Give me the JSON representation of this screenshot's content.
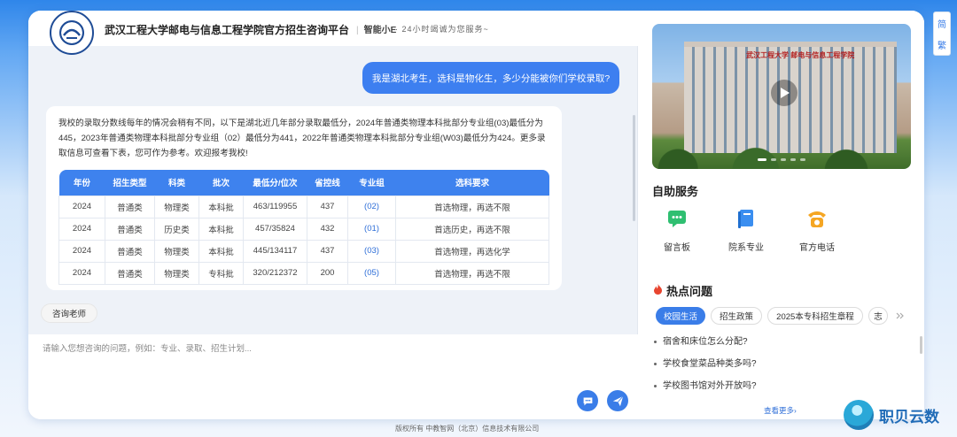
{
  "header": {
    "title": "武汉工程大学邮电与信息工程学院官方招生咨询平台",
    "brand": "智能小E",
    "slogan": "24小时竭诚为您服务~"
  },
  "chat": {
    "user_message": "我是湖北考生，选科是物化生，多少分能被你们学校录取?",
    "bot_message": "我校的录取分数线每年的情况会稍有不同，以下是湖北近几年部分录取最低分，2024年普通类物理本科批部分专业组(03)最低分为445，2023年普通类物理本科批部分专业组（02）最低分为441，2022年普通类物理本科批部分专业组(W03)最低分为424。更多录取信息可查看下表，您可作为参考。欢迎报考我校!",
    "table": {
      "headers": [
        "年份",
        "招生类型",
        "科类",
        "批次",
        "最低分/位次",
        "省控线",
        "专业组",
        "选科要求"
      ],
      "rows": [
        [
          "2024",
          "普通类",
          "物理类",
          "本科批",
          "463/119955",
          "437",
          "(02)",
          "首选物理，再选不限"
        ],
        [
          "2024",
          "普通类",
          "历史类",
          "本科批",
          "457/35824",
          "432",
          "(01)",
          "首选历史，再选不限"
        ],
        [
          "2024",
          "普通类",
          "物理类",
          "本科批",
          "445/134117",
          "437",
          "(03)",
          "首选物理，再选化学"
        ],
        [
          "2024",
          "普通类",
          "物理类",
          "专科批",
          "320/212372",
          "200",
          "(05)",
          "首选物理，再选不限"
        ]
      ]
    },
    "teacher_button": "咨询老师",
    "input_placeholder": "请输入您想咨询的问题，例如：专业、录取、招生计划..."
  },
  "sidebar": {
    "video_sign": "武汉工程大学 邮电与信息工程学院",
    "self_service_title": "自助服务",
    "services": [
      {
        "label": "留言板",
        "icon": "message-board-icon",
        "color": "#2fbf71"
      },
      {
        "label": "院系专业",
        "icon": "book-icon",
        "color": "#3a8ef0"
      },
      {
        "label": "官方电话",
        "icon": "phone-icon",
        "color": "#f5a623"
      }
    ],
    "hot_title": "热点问题",
    "tabs": [
      "校园生活",
      "招生政策",
      "2025本专科招生章程",
      "志"
    ],
    "questions": [
      "宿舍和床位怎么分配?",
      "学校食堂菜品种类多吗?",
      "学校图书馆对外开放吗?"
    ],
    "more": "查看更多"
  },
  "lang": {
    "simplified": "简",
    "traditional": "繁"
  },
  "footer": "版权所有  中教智网（北京）信息技术有限公司",
  "watermark": "职贝云数",
  "colors": {
    "accent": "#3a7de8",
    "hot": "#e8452f"
  }
}
